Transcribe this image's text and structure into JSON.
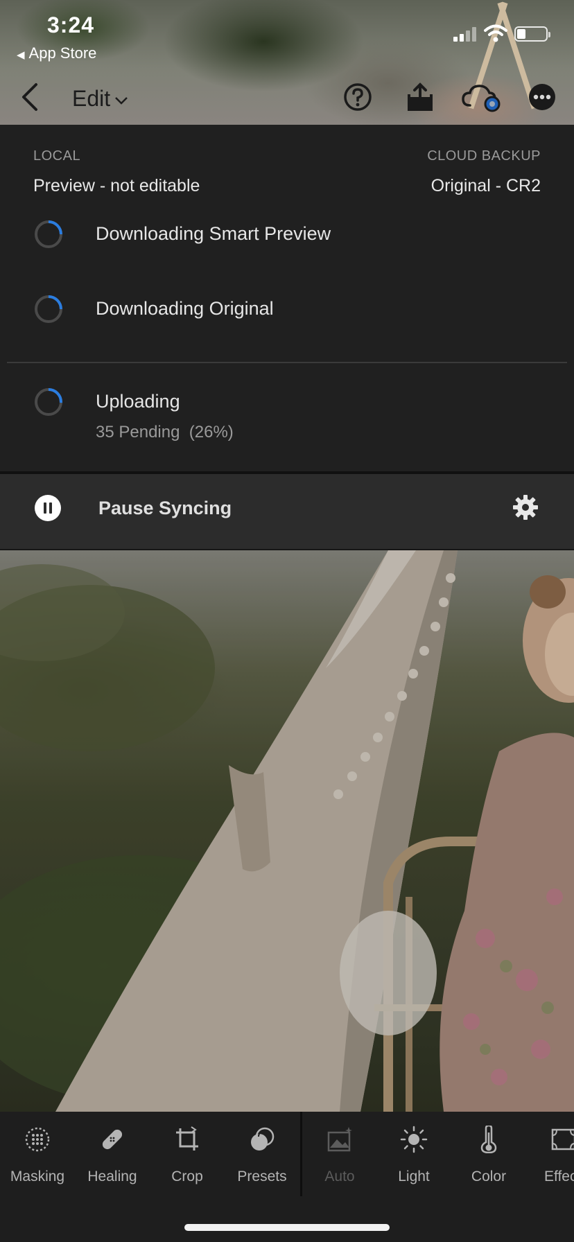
{
  "status_bar": {
    "time": "3:24",
    "back_app": "App Store"
  },
  "nav": {
    "edit_label": "Edit",
    "icons": [
      "back-chevron-icon",
      "help-icon",
      "share-icon",
      "cloud-sync-icon",
      "more-icon"
    ]
  },
  "sync_panel": {
    "local_label": "LOCAL",
    "local_value": "Preview - not editable",
    "cloud_label": "CLOUD BACKUP",
    "cloud_value": "Original - CR2",
    "tasks": [
      {
        "title": "Downloading Smart Preview",
        "progress": 0.25
      },
      {
        "title": "Downloading Original",
        "progress": 0.25
      },
      {
        "title": "Uploading",
        "subtitle": "35 Pending  (26%)",
        "progress": 0.26
      }
    ],
    "pause_label": "Pause Syncing"
  },
  "toolbar": {
    "tools": [
      {
        "label": "Masking",
        "icon": "masking-icon",
        "enabled": true
      },
      {
        "label": "Healing",
        "icon": "healing-icon",
        "enabled": true
      },
      {
        "label": "Crop",
        "icon": "crop-icon",
        "enabled": true
      },
      {
        "label": "Presets",
        "icon": "presets-icon",
        "enabled": true
      },
      {
        "label": "Auto",
        "icon": "auto-icon",
        "enabled": false
      },
      {
        "label": "Light",
        "icon": "light-icon",
        "enabled": true
      },
      {
        "label": "Color",
        "icon": "color-icon",
        "enabled": true
      },
      {
        "label": "Effec",
        "icon": "effects-icon",
        "enabled": true
      }
    ]
  },
  "colors": {
    "panel_bg": "#202020",
    "sync_bar_bg": "#2c2c2c",
    "spinner_accent": "#2b7de0",
    "spinner_track": "#4a4a4a"
  }
}
